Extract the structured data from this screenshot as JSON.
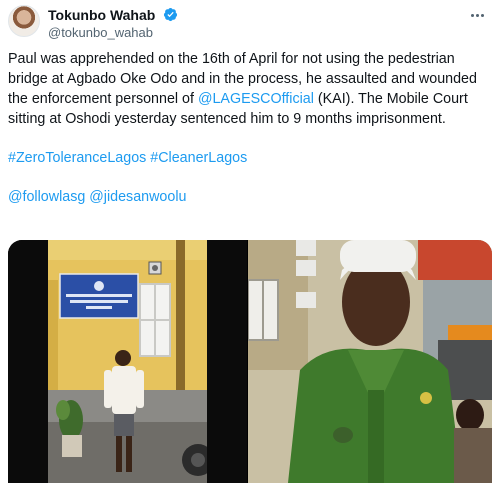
{
  "author": {
    "display_name": "Tokunbo Wahab",
    "handle": "@tokunbo_wahab",
    "avatar_icon": "profile-photo",
    "verified_icon": "verified-badge-icon",
    "verified_color": "#1d9bf0"
  },
  "tweet": {
    "text_part1": "Paul was apprehended on the 16th of April for not using the pedestrian bridge at Agbado Oke Odo and in the process, he assaulted and wounded the enforcement personnel of ",
    "mention_lagesco": "@LAGESCOfficial",
    "text_part2": " (KAI). The Mobile Court sitting at Oshodi yesterday sentenced him to 9 months imprisonment.",
    "hashtag_1": "#ZeroToleranceLagos",
    "hashtag_2": "#CleanerLagos",
    "mention_1": "@followlasg",
    "mention_2": "@jidesanwoolu"
  },
  "media": {
    "left": {
      "sign_text": "LAGOS STATE ENVIRONMENTAL SANITATION CORPS LAGESC",
      "description_icon": "photo-man-standing-by-wall"
    },
    "right": {
      "description_icon": "photo-injured-officer"
    }
  },
  "colors": {
    "link": "#1d9bf0",
    "text": "#0f1419",
    "secondary": "#536471"
  }
}
